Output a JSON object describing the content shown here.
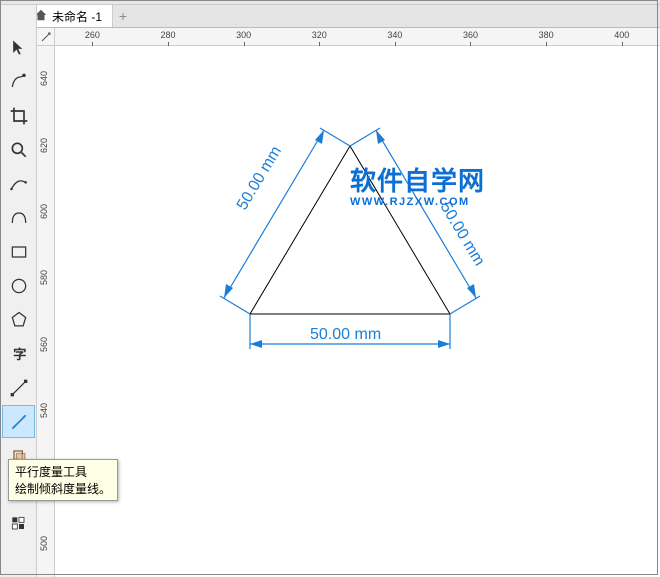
{
  "document": {
    "tab_title": "未命名 -1"
  },
  "ruler_h": {
    "start": 260,
    "end": 400,
    "step": 20
  },
  "ruler_v": {
    "start": 640,
    "end": 500,
    "step": 20
  },
  "dimensions": {
    "left": "50.00 mm",
    "right": "50.00 mm",
    "bottom": "50.00 mm"
  },
  "logo": {
    "cn": "软件自学网",
    "en": "WWW.RJZXW.COM"
  },
  "tooltip": {
    "title": "平行度量工具",
    "desc": "绘制倾斜度量线。"
  },
  "tools": [
    "pick",
    "shape",
    "crop",
    "zoom",
    "freehand",
    "curve",
    "rectangle",
    "ellipse",
    "polygon",
    "text",
    "connector",
    "dimension",
    "effects",
    "dropper",
    "pattern",
    "fill"
  ]
}
